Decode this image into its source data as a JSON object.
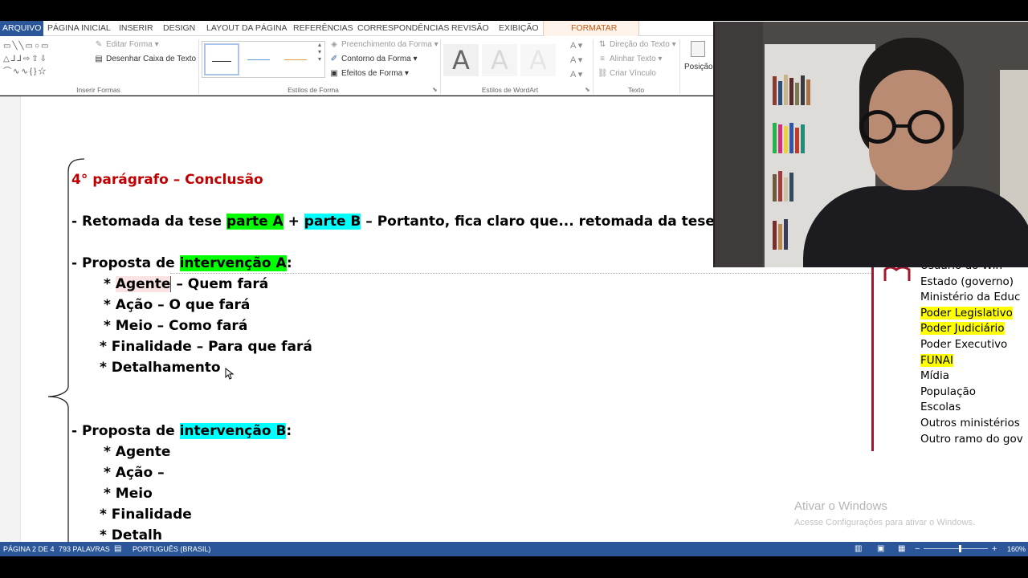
{
  "ribbon_tabs": {
    "file": "ARQUIVO",
    "home": "PÁGINA INICIAL",
    "insert": "INSERIR",
    "design": "DESIGN",
    "layout": "LAYOUT DA PÁGINA",
    "references": "REFERÊNCIAS",
    "mailings": "CORRESPONDÊNCIAS",
    "review": "REVISÃO",
    "view": "EXIBIÇÃO",
    "format": "FORMATAR"
  },
  "ribbon": {
    "insert_shapes": {
      "label": "Inserir Formas",
      "edit_shape": "Editar Forma",
      "draw_text_box": "Desenhar Caixa de Texto"
    },
    "shape_styles": {
      "label": "Estilos de Forma",
      "fill": "Preenchimento da Forma",
      "outline": "Contorno da Forma",
      "effects": "Efeitos de Forma"
    },
    "wordart": {
      "label": "Estilos de WordArt",
      "letter": "A"
    },
    "text": {
      "label": "Texto",
      "direction": "Direção do Texto",
      "align": "Alinhar Texto",
      "link": "Criar Vínculo"
    },
    "position": "Posição"
  },
  "document": {
    "heading": "4° parágrafo – Conclusão",
    "line_thesis": {
      "prefix": "- Retomada da tese ",
      "part_a": "parte A",
      "plus": " + ",
      "part_b": "parte B",
      "suffix": " – Portanto, fica claro que... retomada da tese A e B -"
    },
    "proposal_a": {
      "prefix": "- Proposta de ",
      "highlight": "intervenção A",
      "suffix": ":",
      "agent_star": "* ",
      "agent": "Agente",
      "agent_desc": " – Quem fará",
      "action": "* Ação – O que fará",
      "means": "* Meio – Como fará",
      "purpose": "* Finalidade – Para que fará",
      "detail": "* Detalhamento"
    },
    "proposal_b": {
      "prefix": "- Proposta de ",
      "highlight": "intervenção B",
      "suffix": ":",
      "agent": "* Agente",
      "action": "* Ação –",
      "means": "* Meio",
      "purpose": "* Finalidade",
      "detail": "* Detalh"
    },
    "side_list": [
      {
        "text": "Usuário do Win",
        "highlight": false
      },
      {
        "text": "Estado (governo)",
        "highlight": false
      },
      {
        "text": "Ministério da Educ",
        "highlight": false
      },
      {
        "text": "Poder Legislativo",
        "highlight": true
      },
      {
        "text": "Poder Judiciário",
        "highlight": true
      },
      {
        "text": "Poder Executivo",
        "highlight": false
      },
      {
        "text": "FUNAI",
        "highlight": true
      },
      {
        "text": "Mídia",
        "highlight": false
      },
      {
        "text": "População",
        "highlight": false
      },
      {
        "text": "Escolas",
        "highlight": false
      },
      {
        "text": "Outros ministérios",
        "highlight": false
      },
      {
        "text": "Outro ramo do gov",
        "highlight": false
      }
    ],
    "watermark_title": "Ativar o Windows",
    "watermark_sub": "Acesse Configurações para ativar o Windows."
  },
  "status_bar": {
    "page": "PÁGINA 2 DE 4",
    "words": "793 PALAVRAS",
    "language": "PORTUGUÊS (BRASIL)",
    "zoom": "160%"
  },
  "colors": {
    "accent": "#2b579a",
    "heading_red": "#c00000",
    "highlight_green": "#00ff00",
    "highlight_cyan": "#00ffff",
    "highlight_yellow": "#ffff00"
  }
}
